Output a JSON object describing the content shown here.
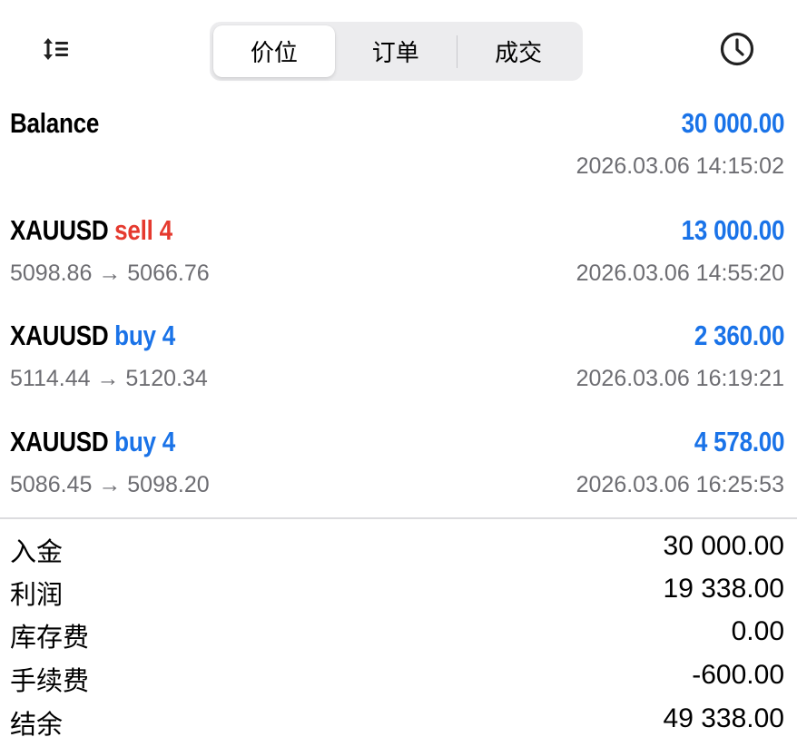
{
  "tabs": [
    {
      "label": "价位",
      "active": true
    },
    {
      "label": "订单",
      "active": false
    },
    {
      "label": "成交",
      "active": false
    }
  ],
  "icons": {
    "sort": "sort-icon",
    "history": "clock-icon"
  },
  "colors": {
    "accent": "#1a73e8",
    "sell": "#e53a2f",
    "muted": "#6d6d72"
  },
  "entries": [
    {
      "title": "Balance",
      "type": "",
      "prices": "",
      "amount": "30 000.00",
      "time": "2026.03.06 14:15:02"
    },
    {
      "title": "XAUUSD",
      "type": "sell 4",
      "prices": "5098.86 → 5066.76",
      "amount": "13 000.00",
      "time": "2026.03.06 14:55:20"
    },
    {
      "title": "XAUUSD",
      "type": "buy 4",
      "prices": "5114.44 → 5120.34",
      "amount": "2 360.00",
      "time": "2026.03.06 16:19:21"
    },
    {
      "title": "XAUUSD",
      "type": "buy 4",
      "prices": "5086.45 → 5098.20",
      "amount": "4 578.00",
      "time": "2026.03.06 16:25:53"
    }
  ],
  "summary": [
    {
      "label": "入金",
      "value": "30 000.00"
    },
    {
      "label": "利润",
      "value": "19 338.00"
    },
    {
      "label": "库存费",
      "value": "0.00"
    },
    {
      "label": "手续费",
      "value": "-600.00"
    },
    {
      "label": "结余",
      "value": "49 338.00"
    }
  ]
}
